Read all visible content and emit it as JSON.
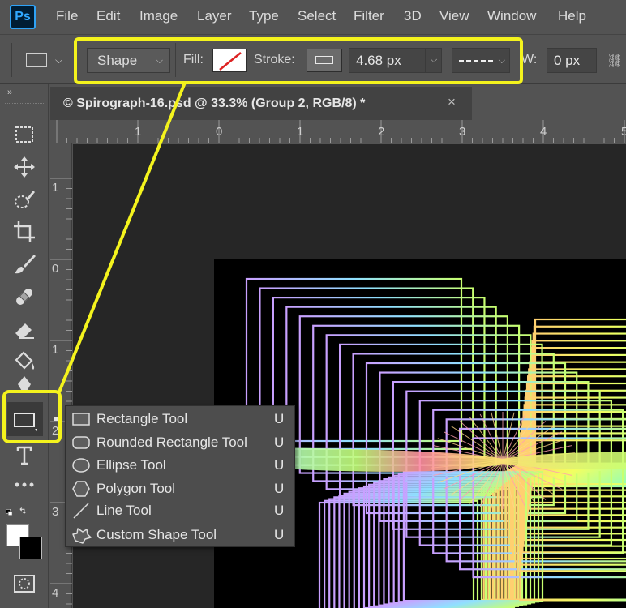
{
  "app": {
    "logo": "Ps"
  },
  "menu": [
    "File",
    "Edit",
    "Image",
    "Layer",
    "Type",
    "Select",
    "Filter",
    "3D",
    "View",
    "Window",
    "Help"
  ],
  "options_bar": {
    "mode": "Shape",
    "fill_label": "Fill:",
    "stroke_label": "Stroke:",
    "stroke_width": "4.68 px",
    "w_label": "W:",
    "w_value": "0 px"
  },
  "document": {
    "tab_title": "© Spirograph-16.psd @ 33.3% (Group 2, RGB/8) *",
    "close_glyph": "×"
  },
  "rulers": {
    "horizontal": [
      "1",
      "0",
      "1",
      "2",
      "3",
      "4",
      "5"
    ],
    "vertical": [
      "1",
      "0",
      "1",
      "2",
      "3",
      "4"
    ]
  },
  "flyout": {
    "items": [
      {
        "label": "Rectangle Tool",
        "key": "U",
        "icon": "rectangle-icon",
        "active": true
      },
      {
        "label": "Rounded Rectangle Tool",
        "key": "U",
        "icon": "rounded-rectangle-icon"
      },
      {
        "label": "Ellipse Tool",
        "key": "U",
        "icon": "ellipse-icon"
      },
      {
        "label": "Polygon Tool",
        "key": "U",
        "icon": "polygon-icon"
      },
      {
        "label": "Line Tool",
        "key": "U",
        "icon": "line-icon"
      },
      {
        "label": "Custom Shape Tool",
        "key": "U",
        "icon": "custom-shape-icon"
      }
    ]
  },
  "colors": {
    "highlight": "#f4f31d",
    "foreground": "#ffffff",
    "background": "#000000"
  }
}
